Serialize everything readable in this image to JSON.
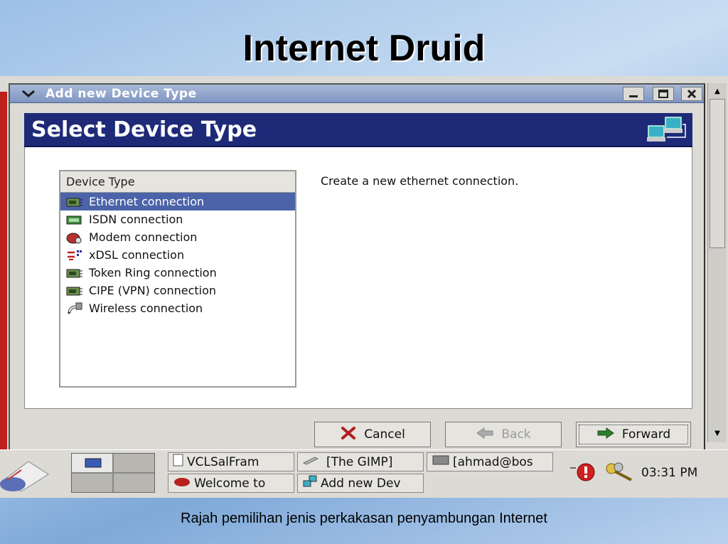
{
  "slide": {
    "title": "Internet Druid",
    "caption": "Rajah pemilihan jenis perkakasan penyambungan Internet"
  },
  "window": {
    "title": "Add new Device Type",
    "banner_title": "Select Device Type",
    "list_header": "Device Type",
    "items": [
      {
        "label": "Ethernet connection",
        "icon": "network-card-icon",
        "selected": true
      },
      {
        "label": "ISDN connection",
        "icon": "isdn-card-icon",
        "selected": false
      },
      {
        "label": "Modem connection",
        "icon": "modem-icon",
        "selected": false
      },
      {
        "label": "xDSL connection",
        "icon": "xdsl-icon",
        "selected": false
      },
      {
        "label": "Token Ring connection",
        "icon": "network-card-icon",
        "selected": false
      },
      {
        "label": "CIPE (VPN) connection",
        "icon": "network-card-icon",
        "selected": false
      },
      {
        "label": "Wireless connection",
        "icon": "wireless-icon",
        "selected": false
      }
    ],
    "description": "Create a new ethernet connection.",
    "buttons": {
      "cancel": "Cancel",
      "back": "Back",
      "forward": "Forward"
    }
  },
  "taskbar": {
    "tasks": [
      "VCLSalFram",
      "[The GIMP]",
      "[ahmad@bos",
      "Welcome to",
      "Add new Dev"
    ],
    "clock": "03:31 PM"
  },
  "colors": {
    "banner": "#1e2a78",
    "selection": "#4b63a8",
    "titlebar": "#8fa3cc"
  }
}
